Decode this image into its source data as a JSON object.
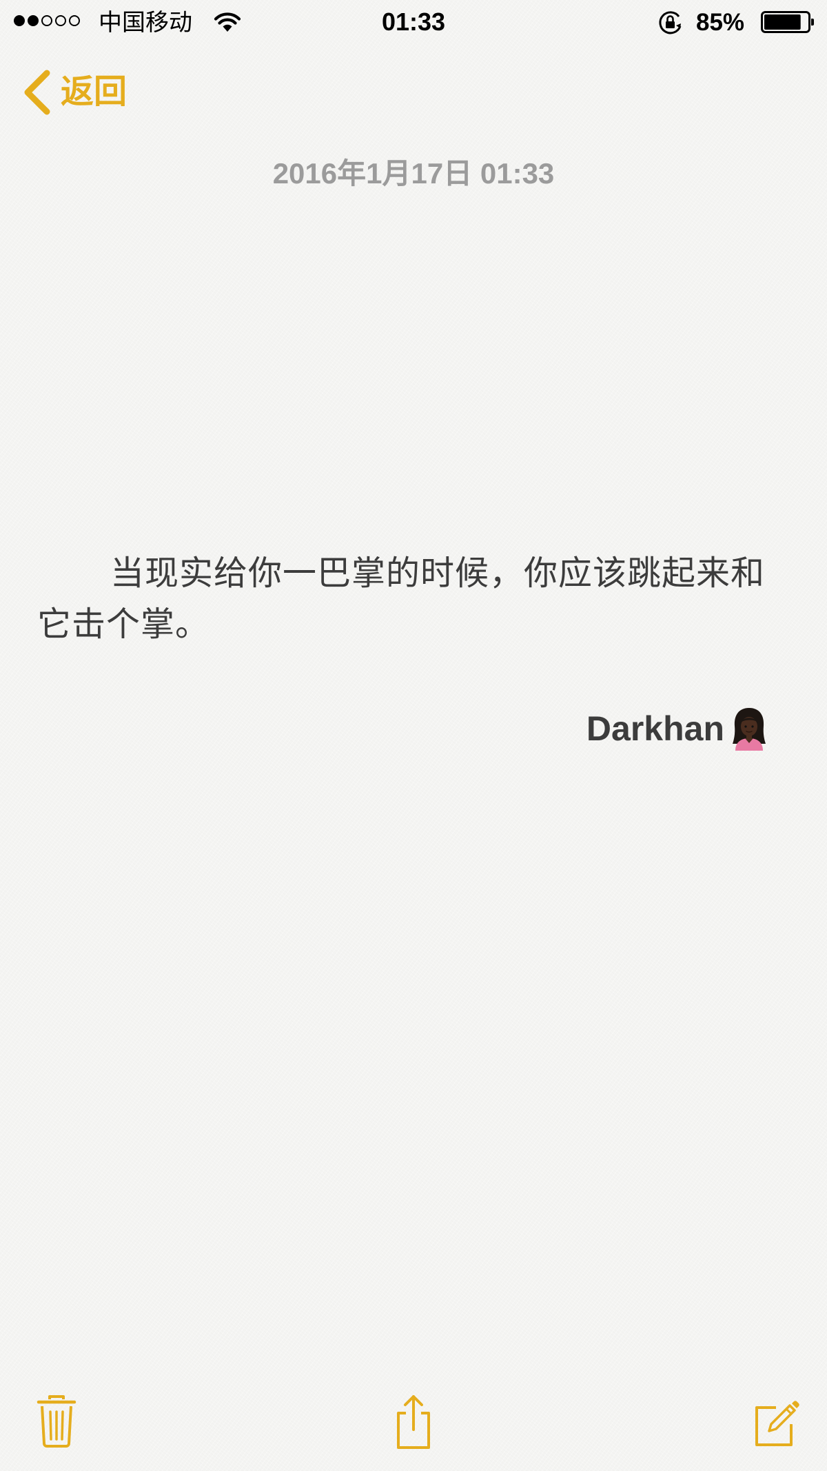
{
  "status_bar": {
    "signal_dots": [
      true,
      true,
      false,
      false,
      false
    ],
    "carrier": "中国移动",
    "time": "01:33",
    "battery_percent": "85%",
    "battery_level": 0.85,
    "wifi_icon": "wifi-icon",
    "lock_icon": "orientation-lock-icon"
  },
  "nav": {
    "back_label": "返回",
    "back_icon": "chevron-left-icon"
  },
  "note": {
    "date": "2016年1月17日 01:33",
    "body": "当现实给你一巴掌的时候，你应该跳起来和它击个掌。",
    "signature": "Darkhan"
  },
  "toolbar": {
    "items": [
      "trash-icon",
      "share-icon",
      "compose-icon"
    ]
  },
  "colors": {
    "accent": "#e5ad1d",
    "date_text": "#9b9b9b",
    "body_text": "#3c3c3c",
    "background": "#f4f4f2"
  }
}
